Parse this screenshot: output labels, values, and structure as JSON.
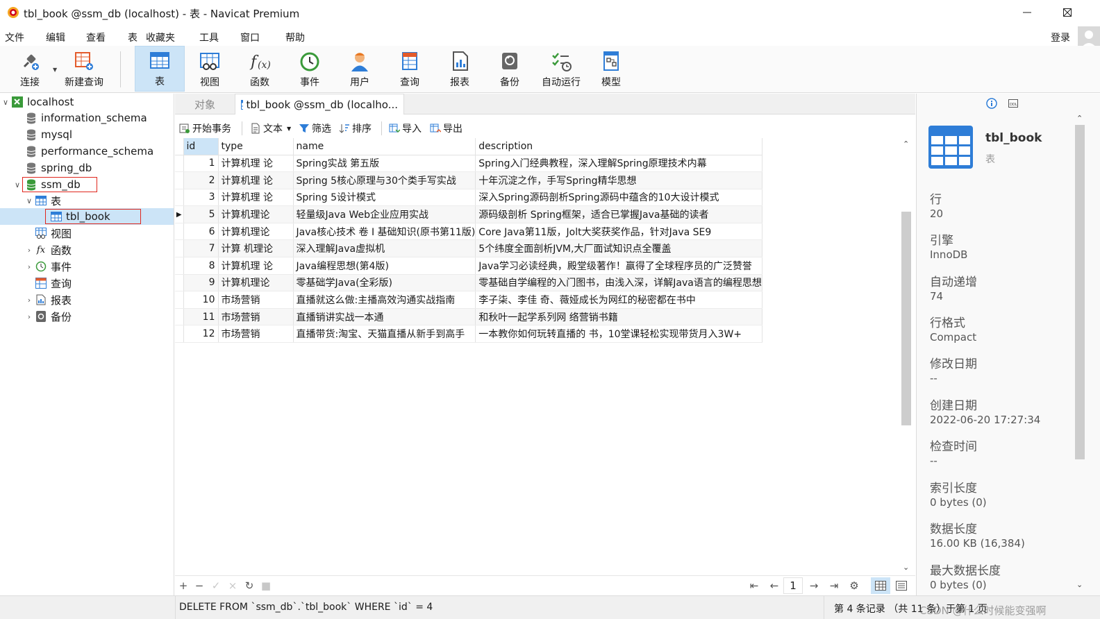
{
  "window": {
    "title": "tbl_book @ssm_db (localhost) - 表 - Navicat Premium"
  },
  "menu": [
    "文件",
    "编辑",
    "查看",
    "表",
    "收藏夹",
    "工具",
    "窗口",
    "帮助"
  ],
  "login_label": "登录",
  "toolbar": {
    "connect": "连接",
    "new_query": "新建查询",
    "table": "表",
    "view": "视图",
    "function": "函数",
    "event": "事件",
    "user": "用户",
    "query": "查询",
    "report": "报表",
    "backup": "备份",
    "automation": "自动运行",
    "model": "模型"
  },
  "tree": {
    "root": "localhost",
    "databases": [
      "information_schema",
      "mysql",
      "performance_schema",
      "spring_db",
      "ssm_db"
    ],
    "tables_node": "表",
    "selected_table": "tbl_book",
    "children": [
      "视图",
      "函数",
      "事件",
      "查询",
      "报表",
      "备份"
    ]
  },
  "tabs": {
    "objects": "对象",
    "active": "tbl_book @ssm_db (localho..."
  },
  "grid_toolbar": {
    "begin_tx": "开始事务",
    "text": "文本",
    "filter": "筛选",
    "sort": "排序",
    "import": "导入",
    "export": "导出"
  },
  "table": {
    "columns": [
      "id",
      "type",
      "name",
      "description"
    ],
    "rows": [
      [
        "1",
        "计算机理 论",
        "Spring实战 第五版",
        "Spring入门经典教程，深入理解Spring原理技术内幕"
      ],
      [
        "2",
        "计算机理 论",
        "Spring 5核心原理与30个类手写实战",
        "十年沉淀之作，手写Spring精华思想"
      ],
      [
        "3",
        "计算机理 论",
        "Spring 5设计模式",
        "深入Spring源码剖析Spring源码中蕴含的10大设计模式"
      ],
      [
        "5",
        "计算机理论",
        "轻量级Java Web企业应用实战",
        "源码级剖析 Spring框架，适合已掌握Java基础的读者"
      ],
      [
        "6",
        "计算机理论",
        "Java核心技术 卷 I  基础知识(原书第11版)",
        "Core Java第11版，Jolt大奖获奖作品，针对Java SE9"
      ],
      [
        "7",
        "计算 机理论",
        "深入理解Java虚拟机",
        "5个纬度全面剖析JVM,大厂面试知识点全覆盖"
      ],
      [
        "8",
        "计算机理 论",
        "Java编程思想(第4版)",
        "Java学习必读经典，殿堂级著作！赢得了全球程序员的广泛赞誉"
      ],
      [
        "9",
        "计算机理论",
        "零基础学Java(全彩版)",
        "零基础自学编程的入门图书，由浅入深，详解Java语言的编程思想"
      ],
      [
        "10",
        "市场营销",
        "直播就这么做:主播高效沟通实战指南",
        "李子柒、李佳 奇、薇娅成长为网红的秘密都在书中"
      ],
      [
        "11",
        "市场营销",
        "直播销讲实战一本通",
        "和秋叶一起学系列网 络营销书籍"
      ],
      [
        "12",
        "市场营销",
        "直播带货:淘宝、天猫直播从新手到高手",
        "一本教你如何玩转直播的 书，10堂课轻松实现带货月入3W+"
      ]
    ]
  },
  "pager": {
    "page": "1"
  },
  "status": {
    "sql": "DELETE FROM `ssm_db`.`tbl_book` WHERE `id` = 4",
    "record": "第 4 条记录 （共 11 条）于第 1 页",
    "watermark": "CSDN @什么时候能变强啊"
  },
  "info": {
    "name": "tbl_book",
    "kind": "表",
    "props": [
      {
        "label": "行",
        "value": "20"
      },
      {
        "label": "引擎",
        "value": "InnoDB"
      },
      {
        "label": "自动递增",
        "value": "74"
      },
      {
        "label": "行格式",
        "value": "Compact"
      },
      {
        "label": "修改日期",
        "value": "--"
      },
      {
        "label": "创建日期",
        "value": "2022-06-20 17:27:34"
      },
      {
        "label": "检查时间",
        "value": "--"
      },
      {
        "label": "索引长度",
        "value": "0 bytes (0)"
      },
      {
        "label": "数据长度",
        "value": "16.00 KB (16,384)"
      },
      {
        "label": "最大数据长度",
        "value": "0 bytes (0)"
      }
    ]
  },
  "colors": {
    "selection": "#cce4f7",
    "highlight_box": "#e0261c",
    "tree_selected": "#cce4f7"
  }
}
